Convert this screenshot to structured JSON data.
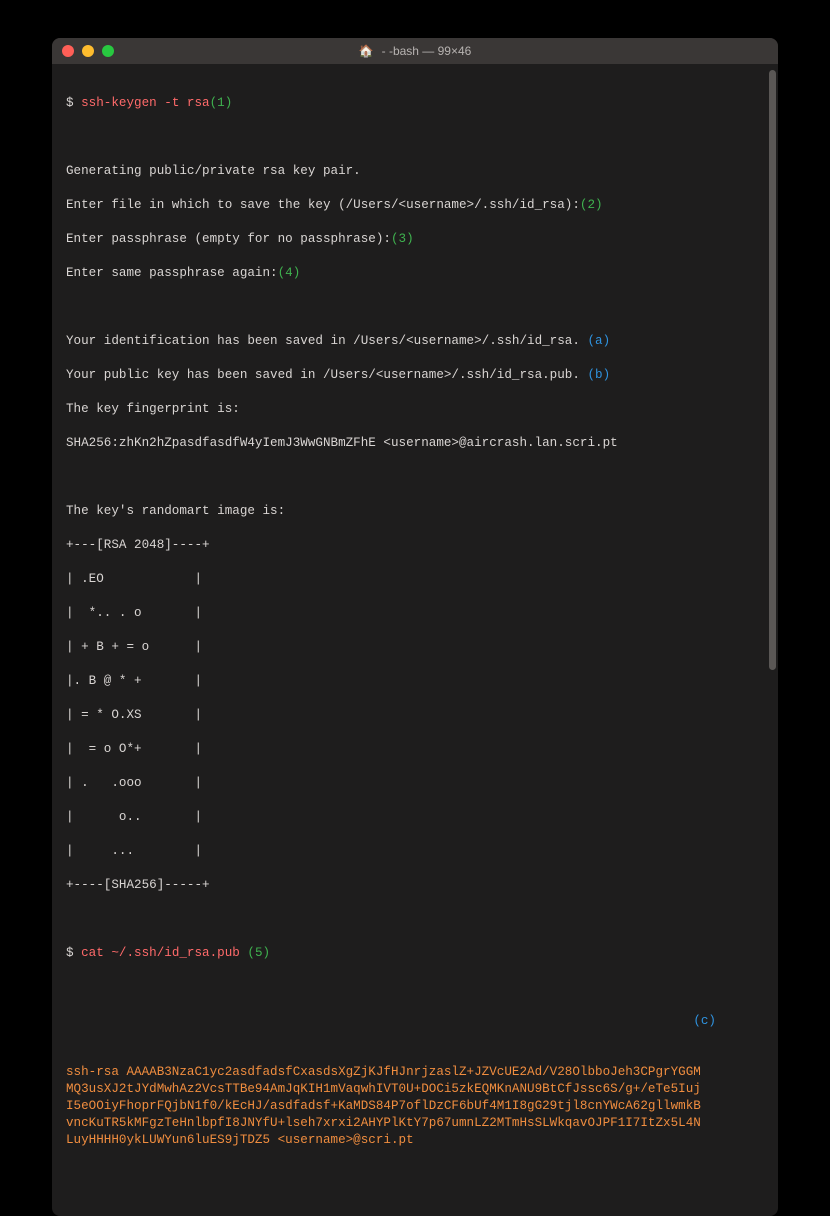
{
  "window": {
    "title": "- -bash — 99×46",
    "home_icon_glyph": "🏠"
  },
  "prompt_symbol": "$ ",
  "commands": {
    "sshkeygen": "ssh-keygen -t rsa",
    "cat": "cat ~/.ssh/id_rsa.pub"
  },
  "annotations": {
    "one": "(1)",
    "two": "(2)",
    "three": "(3)",
    "four": "(4)",
    "five": "(5)",
    "a": "(a)",
    "b": "(b)",
    "c": "(c)"
  },
  "lines": {
    "gen": "Generating public/private rsa key pair.",
    "enter_file": "Enter file in which to save the key (/Users/<username>/.ssh/id_rsa):",
    "enter_pass": "Enter passphrase (empty for no passphrase):",
    "enter_pass_again": "Enter same passphrase again:",
    "id_saved": "Your identification has been saved in /Users/<username>/.ssh/id_rsa. ",
    "pub_saved": "Your public key has been saved in /Users/<username>/.ssh/id_rsa.pub. ",
    "fp_is": "The key fingerprint is:",
    "fp_value": "SHA256:zhKn2hZpasdfasdfW4yIemJ3WwGNBmZFhE <username>@aircrash.lan.scri.pt",
    "randomart_title": "The key's randomart image is:",
    "r0": "+---[RSA 2048]----+",
    "r1": "| .EO            |",
    "r2": "|  *.. . o       |",
    "r3": "| + B + = o      |",
    "r4": "|. B @ * +       |",
    "r5": "| = * O.XS       |",
    "r6": "|  = o O*+       |",
    "r7": "| .   .ooo       |",
    "r8": "|      o..       |",
    "r9": "|     ...        |",
    "r10": "+----[SHA256]-----+",
    "pubkey": "ssh-rsa AAAAB3NzaC1yc2asdfadsfCxasdsXgZjKJfHJnrjzaslZ+JZVcUE2Ad/V28OlbboJeh3CPgrYGGMMQ3usXJ2tJYdMwhAz2VcsTTBe94AmJqKIH1mVaqwhIVT0U+DOCi5zkEQMKnANU9BtCfJssc6S/g+/eTe5IujI5eOOiyFhoprFQjbN1f0/kEcHJ/asdfadsf+KaMDS84P7oflDzCF6bUf4M1I8gG29tjl8cnYWcA62gllwmkBvncKuTR5kMFgzTeHnlbpfI8JNYfU+lseh7xrxi2AHYPlKtY7p67umnLZ2MTmHsSLWkqavOJPF1I7ItZx5L4NLuyHHHH0ykLUWYun6luES9jTDZ5 <username>@scri.pt"
  }
}
